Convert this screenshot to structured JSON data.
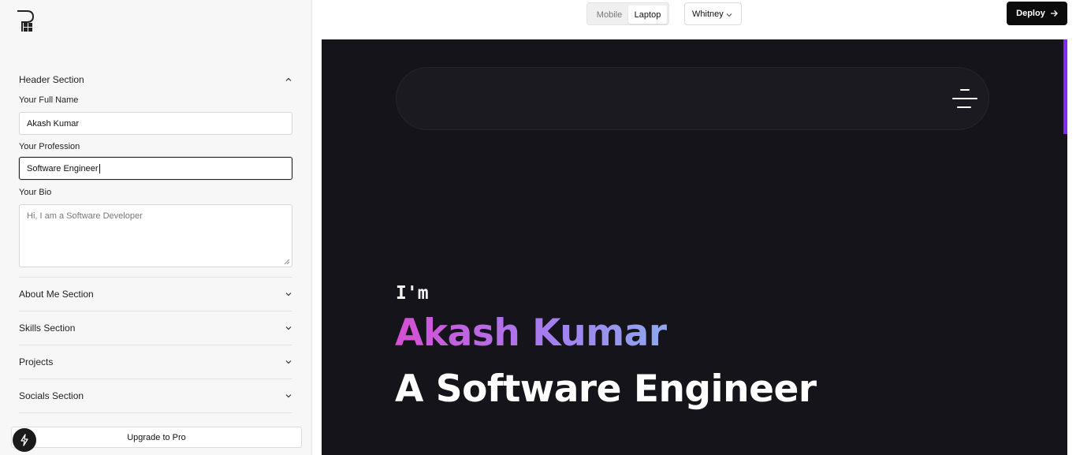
{
  "sidebar": {
    "header_section": {
      "title": "Header Section",
      "full_name_label": "Your Full Name",
      "full_name_value": "Akash Kumar",
      "profession_label": "Your Profession",
      "profession_value": "Software Engineer",
      "bio_label": "Your Bio",
      "bio_placeholder": "Hi, I am a Software Developer"
    },
    "sections": [
      {
        "title": "About Me Section"
      },
      {
        "title": "Skills Section"
      },
      {
        "title": "Projects"
      },
      {
        "title": "Socials Section"
      }
    ],
    "upgrade_label": "Upgrade to Pro"
  },
  "topbar": {
    "device_options": [
      "Mobile",
      "Laptop"
    ],
    "selected_device": "Laptop",
    "theme_value": "Whitney",
    "deploy_label": "Deploy"
  },
  "preview": {
    "intro": "I'm",
    "name": "Akash Kumar",
    "profession_line": "A Software Engineer"
  },
  "colors": {
    "accent_scroll": "#7c2cf5",
    "preview_bg": "#15141b",
    "name_gradient_start": "#d64fd2",
    "name_gradient_end": "#8fa8ee"
  }
}
